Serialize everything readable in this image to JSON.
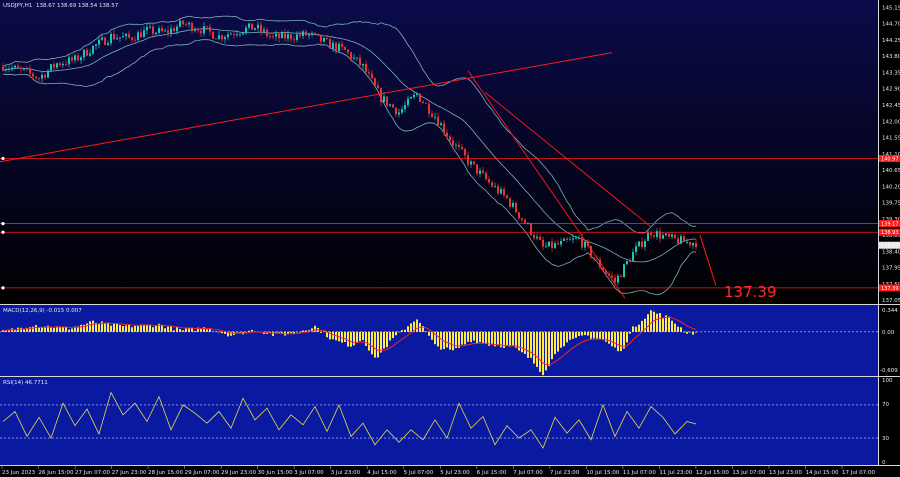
{
  "header": {
    "symbol_info": "USDJPY,H1",
    "ohlc": "138.67 138.69 138.54 138.57"
  },
  "macd": {
    "label": "MACD(12,26,9) -0.015 0.007",
    "scale": [
      "0.344",
      "0.00",
      "-0.609"
    ]
  },
  "rsi": {
    "label": "RSI(14) 46.7711",
    "scale": [
      "100",
      "70",
      "30",
      "0"
    ]
  },
  "price_scale": [
    "145.15",
    "144.70",
    "144.25",
    "143.80",
    "143.35",
    "142.90",
    "142.45",
    "142.00",
    "141.55",
    "141.10",
    "140.65",
    "140.20",
    "139.75",
    "139.30",
    "138.85",
    "138.40",
    "137.95",
    "137.50",
    "137.05"
  ],
  "level_tags": {
    "upper": "140.97",
    "resistance": "139.17",
    "resistance_2": "138.93",
    "current": "138.57",
    "support": "137.39"
  },
  "callout": "137.39",
  "time_axis": [
    "23 Jun 2023",
    "26 Jun 15:00",
    "27 Jun 07:00",
    "27 Jun 23:00",
    "28 Jun 15:00",
    "29 Jun 07:00",
    "29 Jun 23:00",
    "30 Jun 15:00",
    "3 Jul 07:00",
    "3 Jul 23:00",
    "4 Jul 15:00",
    "5 Jul 07:00",
    "5 Jul 23:00",
    "6 Jul 15:00",
    "7 Jul 07:00",
    "7 Jul 23:00",
    "10 Jul 15:00",
    "11 Jul 07:00",
    "11 Jul 23:00",
    "12 Jul 15:00",
    "13 Jul 07:00",
    "13 Jul 23:00",
    "14 Jul 15:00",
    "17 Jul 07:00"
  ],
  "colors": {
    "bg_top": "#0b0b4a",
    "bg_bottom": "#000000",
    "panel_blue": "#0a1aa0",
    "bull": "#19c7b4",
    "bear": "#e8332f",
    "bands": "#8fcfcf",
    "trend": "#ff1a1a",
    "histogram": "#ffe94a",
    "signal": "#ff2020",
    "rsi_line": "#e6d84a"
  },
  "chart_data": [
    {
      "type": "candlestick",
      "title": "USDJPY,H1",
      "ylim": [
        137.0,
        145.3
      ],
      "bollinger_bands": true,
      "horizontal_levels": [
        140.97,
        139.17,
        138.93,
        137.39
      ],
      "close_path": [
        [
          0,
          143.55
        ],
        [
          6,
          143.4
        ],
        [
          12,
          143.2
        ],
        [
          18,
          143.6
        ],
        [
          24,
          143.7
        ],
        [
          30,
          144.05
        ],
        [
          36,
          144.35
        ],
        [
          42,
          144.3
        ],
        [
          48,
          144.5
        ],
        [
          54,
          144.45
        ],
        [
          60,
          144.7
        ],
        [
          66,
          144.55
        ],
        [
          72,
          144.35
        ],
        [
          78,
          144.5
        ],
        [
          84,
          144.6
        ],
        [
          90,
          144.3
        ],
        [
          96,
          144.35
        ],
        [
          102,
          144.4
        ],
        [
          108,
          144.15
        ],
        [
          114,
          143.95
        ],
        [
          120,
          143.5
        ],
        [
          126,
          142.65
        ],
        [
          132,
          142.25
        ],
        [
          138,
          142.75
        ],
        [
          144,
          142.15
        ],
        [
          150,
          141.4
        ],
        [
          156,
          140.8
        ],
        [
          162,
          140.3
        ],
        [
          168,
          139.85
        ],
        [
          174,
          139.2
        ],
        [
          180,
          138.5
        ],
        [
          186,
          138.6
        ],
        [
          192,
          138.75
        ],
        [
          198,
          138.1
        ],
        [
          204,
          137.55
        ],
        [
          210,
          138.35
        ],
        [
          216,
          138.95
        ],
        [
          222,
          138.75
        ],
        [
          228,
          138.65
        ]
      ],
      "start": 143.5
    },
    {
      "type": "bar",
      "name": "MACD(12,26,9)",
      "signal_value": 0.007,
      "last_value": -0.015,
      "ylim": [
        -0.609,
        0.344
      ],
      "path": [
        [
          0,
          0.0
        ],
        [
          10,
          0.1
        ],
        [
          22,
          0.05
        ],
        [
          30,
          0.14
        ],
        [
          40,
          0.08
        ],
        [
          52,
          0.1
        ],
        [
          60,
          0.02
        ],
        [
          68,
          0.06
        ],
        [
          76,
          -0.05
        ],
        [
          84,
          0.03
        ],
        [
          90,
          -0.04
        ],
        [
          96,
          -0.03
        ],
        [
          104,
          0.08
        ],
        [
          110,
          -0.12
        ],
        [
          116,
          -0.2
        ],
        [
          120,
          -0.1
        ],
        [
          124,
          -0.4
        ],
        [
          130,
          -0.1
        ],
        [
          138,
          0.2
        ],
        [
          144,
          -0.2
        ],
        [
          150,
          -0.28
        ],
        [
          156,
          -0.12
        ],
        [
          162,
          -0.18
        ],
        [
          170,
          -0.22
        ],
        [
          176,
          -0.4
        ],
        [
          180,
          -0.6
        ],
        [
          186,
          -0.2
        ],
        [
          194,
          -0.05
        ],
        [
          200,
          -0.12
        ],
        [
          206,
          -0.3
        ],
        [
          210,
          0.05
        ],
        [
          216,
          0.3
        ],
        [
          222,
          0.2
        ],
        [
          228,
          -0.015
        ]
      ]
    },
    {
      "type": "line",
      "name": "RSI(14)",
      "last_value": 46.7711,
      "ylim": [
        0,
        100
      ],
      "levels": [
        70,
        30
      ],
      "points": [
        [
          0,
          50
        ],
        [
          4,
          62
        ],
        [
          8,
          32
        ],
        [
          12,
          55
        ],
        [
          16,
          30
        ],
        [
          20,
          72
        ],
        [
          24,
          45
        ],
        [
          28,
          65
        ],
        [
          32,
          35
        ],
        [
          36,
          85
        ],
        [
          40,
          58
        ],
        [
          44,
          72
        ],
        [
          48,
          50
        ],
        [
          52,
          80
        ],
        [
          56,
          40
        ],
        [
          60,
          70
        ],
        [
          64,
          60
        ],
        [
          68,
          48
        ],
        [
          72,
          62
        ],
        [
          76,
          42
        ],
        [
          80,
          78
        ],
        [
          84,
          52
        ],
        [
          88,
          66
        ],
        [
          92,
          40
        ],
        [
          96,
          58
        ],
        [
          100,
          46
        ],
        [
          104,
          68
        ],
        [
          108,
          38
        ],
        [
          112,
          70
        ],
        [
          116,
          32
        ],
        [
          120,
          48
        ],
        [
          124,
          22
        ],
        [
          128,
          40
        ],
        [
          132,
          25
        ],
        [
          136,
          40
        ],
        [
          140,
          28
        ],
        [
          144,
          52
        ],
        [
          148,
          30
        ],
        [
          152,
          72
        ],
        [
          156,
          42
        ],
        [
          160,
          56
        ],
        [
          164,
          22
        ],
        [
          168,
          45
        ],
        [
          172,
          30
        ],
        [
          176,
          40
        ],
        [
          180,
          18
        ],
        [
          184,
          55
        ],
        [
          188,
          36
        ],
        [
          192,
          52
        ],
        [
          196,
          28
        ],
        [
          200,
          70
        ],
        [
          204,
          32
        ],
        [
          208,
          62
        ],
        [
          212,
          42
        ],
        [
          216,
          68
        ],
        [
          220,
          55
        ],
        [
          224,
          35
        ],
        [
          228,
          50
        ],
        [
          231,
          47
        ]
      ]
    }
  ]
}
